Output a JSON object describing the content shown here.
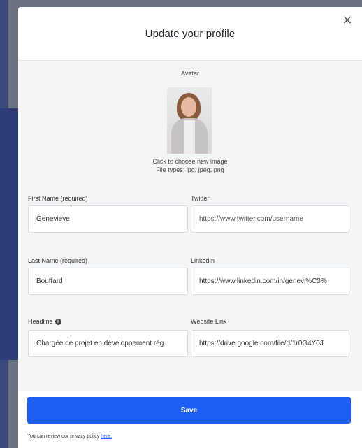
{
  "modal": {
    "title": "Update your profile",
    "close_label": "×"
  },
  "avatar": {
    "label": "Avatar",
    "hint_line1": "Click to choose new image",
    "hint_line2": "File types: jpg, jpeg, png"
  },
  "fields": {
    "first_name": {
      "label": "First Name (required)",
      "value": "Genevieve"
    },
    "last_name": {
      "label": "Last Name (required)",
      "value": "Bouffard"
    },
    "headline": {
      "label": "Headline",
      "value": "Chargée de projet en développement rég"
    },
    "twitter": {
      "label": "Twitter",
      "placeholder": "https://www.twitter.com/username"
    },
    "linkedin": {
      "label": "LinkedIn",
      "value": "https://www.linkedin.com/in/genevi%C3%"
    },
    "website": {
      "label": "Website Link",
      "value": "https://drive.google.com/file/d/1r0G4Y0J"
    }
  },
  "footer": {
    "save_label": "Save",
    "privacy_text": "You can review our privacy policy",
    "privacy_link": "here."
  },
  "colors": {
    "accent": "#1f5ef5"
  }
}
